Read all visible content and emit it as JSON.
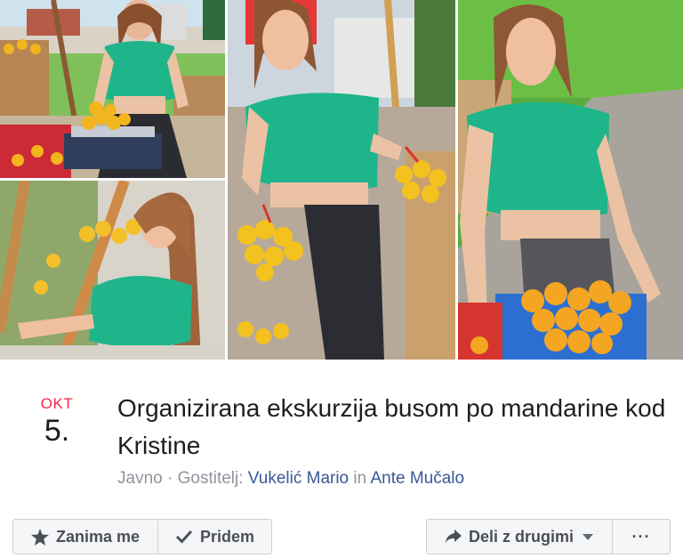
{
  "photos": [
    {
      "name": "photo-market-stall-scale",
      "subject": "woman at fruit stand with scale and mandarins"
    },
    {
      "name": "photo-leaning-stand",
      "subject": "woman leaning on wooden market stand"
    },
    {
      "name": "photo-holding-nets",
      "subject": "woman holding two nets of mandarins"
    },
    {
      "name": "photo-crate-of-mandarins",
      "subject": "woman behind crate of mandarins"
    }
  ],
  "event": {
    "month": "OKT",
    "day": "5.",
    "title": "Organizirana ekskurzija busom po mandarine kod Kristine",
    "privacy": "Javno",
    "separator": " · ",
    "host_label": "Gostitelj: ",
    "host_1": "Vukelić Mario",
    "joiner": " in ",
    "host_2": "Ante Mučalo"
  },
  "actions": {
    "interested": "Zanima me",
    "going": "Pridem",
    "share": "Deli z drugimi",
    "more": "···"
  },
  "colors": {
    "month": "#f02849",
    "link": "#385898",
    "muted": "#90949c",
    "shirt": "#1fb58a",
    "mandarin": "#f5a623"
  }
}
